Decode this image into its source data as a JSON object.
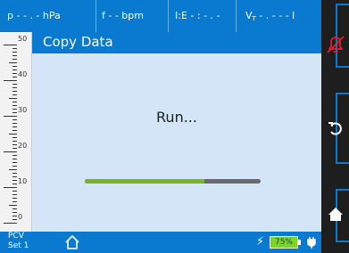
{
  "topbar": {
    "pressure": "p - - . -  hPa",
    "frequency": "f - -  bpm",
    "ie_ratio": "I:E - : - . -",
    "volume_symbol": "V",
    "volume_sub": "T",
    "volume_value": " - . - - -  l"
  },
  "scale": {
    "labels": [
      "50",
      "40",
      "30",
      "20",
      "10",
      "0"
    ]
  },
  "dialog": {
    "title": "Copy Data",
    "status": "Run...",
    "progress": 0.68
  },
  "bottombar": {
    "mode_line1": "PCV",
    "mode_line2": "Set 1",
    "battery_percent": "75%"
  },
  "rightpanel": {
    "buttons": [
      "alarm-mute",
      "undo",
      "home"
    ]
  },
  "colors": {
    "header_blue": "#0a7ad0",
    "content_bg": "#d4e5f8",
    "progress_fill": "#78b41e",
    "progress_track": "#6a6a6a",
    "battery_green": "#7fd321",
    "alarm_red": "#e0202a",
    "panel_dark": "#1e1e1e"
  }
}
